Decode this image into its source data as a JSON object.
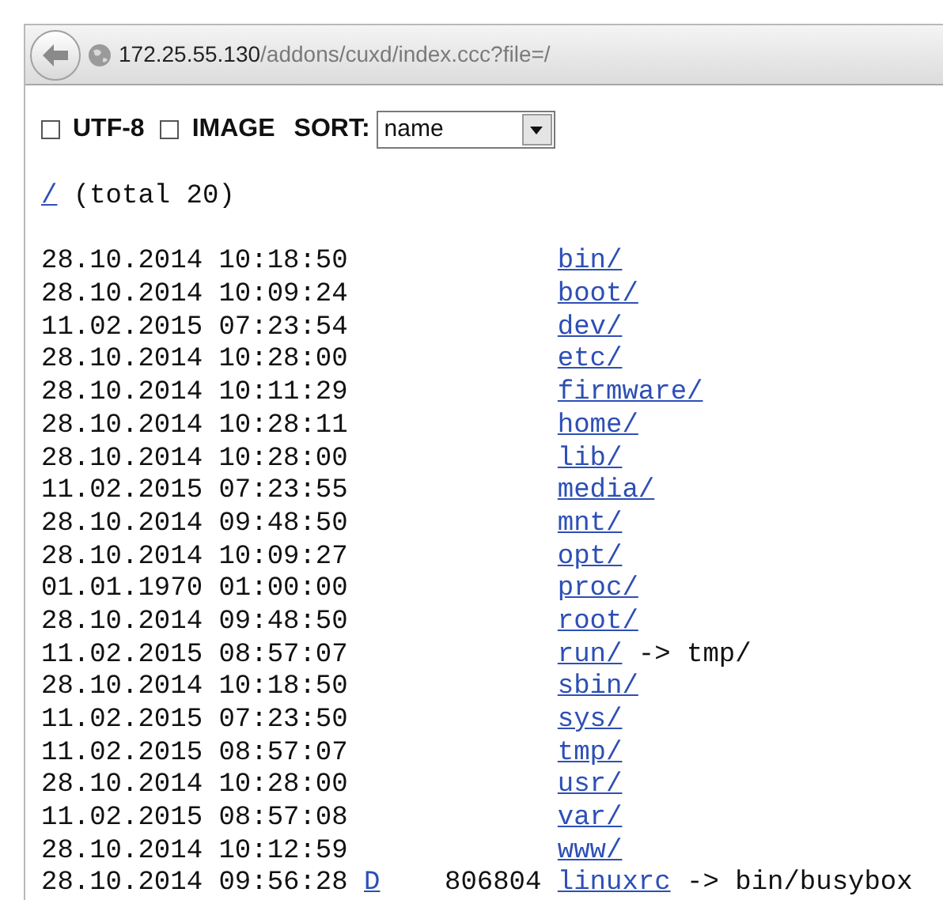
{
  "address_bar": {
    "host": "172.25.55.130",
    "path": "/addons/cuxd/index.ccc?file=/"
  },
  "options": [
    {
      "label": "UTF-8",
      "checked": false
    },
    {
      "label": "IMAGE",
      "checked": false
    }
  ],
  "sort": {
    "label": "SORT:",
    "value": "name"
  },
  "path": {
    "link": "/",
    "summary": "(total 20)"
  },
  "entries": [
    {
      "date": "28.10.2014 10:18:50",
      "name": "bin/"
    },
    {
      "date": "28.10.2014 10:09:24",
      "name": "boot/"
    },
    {
      "date": "11.02.2015 07:23:54",
      "name": "dev/"
    },
    {
      "date": "28.10.2014 10:28:00",
      "name": "etc/"
    },
    {
      "date": "28.10.2014 10:11:29",
      "name": "firmware/"
    },
    {
      "date": "28.10.2014 10:28:11",
      "name": "home/"
    },
    {
      "date": "28.10.2014 10:28:00",
      "name": "lib/"
    },
    {
      "date": "11.02.2015 07:23:55",
      "name": "media/"
    },
    {
      "date": "28.10.2014 09:48:50",
      "name": "mnt/"
    },
    {
      "date": "28.10.2014 10:09:27",
      "name": "opt/"
    },
    {
      "date": "01.01.1970 01:00:00",
      "name": "proc/"
    },
    {
      "date": "28.10.2014 09:48:50",
      "name": "root/"
    },
    {
      "date": "11.02.2015 08:57:07",
      "name": "run/",
      "target": "-> tmp/"
    },
    {
      "date": "28.10.2014 10:18:50",
      "name": "sbin/"
    },
    {
      "date": "11.02.2015 07:23:50",
      "name": "sys/"
    },
    {
      "date": "11.02.2015 08:57:07",
      "name": "tmp/"
    },
    {
      "date": "28.10.2014 10:28:00",
      "name": "usr/"
    },
    {
      "date": "11.02.2015 08:57:08",
      "name": "var/"
    },
    {
      "date": "28.10.2014 10:12:59",
      "name": "www/"
    },
    {
      "date": "28.10.2014 09:56:28",
      "action": "D",
      "size": "806804",
      "name": "linuxrc",
      "target": "-> bin/busybox"
    }
  ]
}
